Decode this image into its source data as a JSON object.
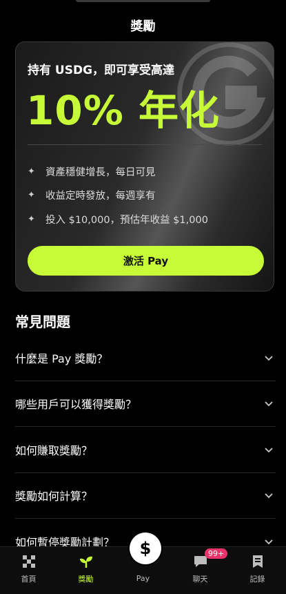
{
  "header": {
    "title": "獎勵"
  },
  "promo": {
    "subtitle": "持有 USDG，即可享受高達",
    "headline": "10% 年化",
    "benefits": [
      "資產穩健增長，每日可見",
      "收益定時發放，每週享有",
      "投入 $10,000，預估年收益 $1,000"
    ],
    "button_label": "激活 Pay",
    "accent_color": "#c7fb37"
  },
  "faq": {
    "title": "常見問題",
    "items": [
      "什麼是 Pay 獎勵？",
      "哪些用戶可以獲得獎勵？",
      "如何賺取獎勵？",
      "獎勵如何計算？",
      "如何暫停獎勵計劃？"
    ]
  },
  "nav": {
    "items": [
      {
        "label": "首頁",
        "icon": "home-icon"
      },
      {
        "label": "獎勵",
        "icon": "rewards-sprout-icon",
        "active": true
      },
      {
        "label": "Pay",
        "icon": "dollar-icon"
      },
      {
        "label": "聊天",
        "icon": "chat-icon",
        "badge": "99+"
      },
      {
        "label": "記錄",
        "icon": "records-icon"
      }
    ],
    "pay_symbol": "$"
  }
}
